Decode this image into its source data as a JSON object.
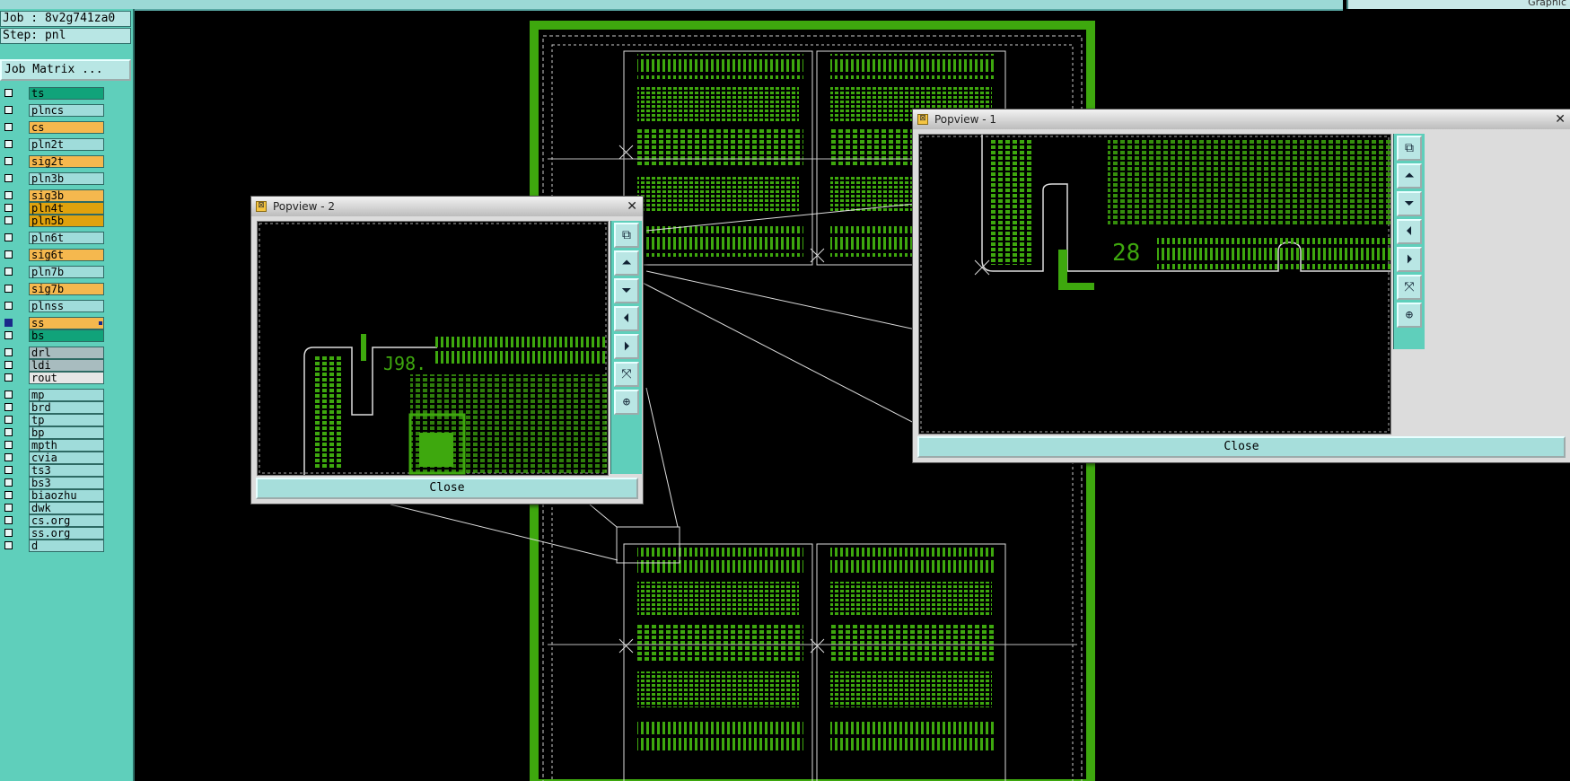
{
  "header": {
    "job": "Job : 8v2g741za0",
    "step": "Step: pnl",
    "job_matrix_button": "Job Matrix ...",
    "right_label": "Graphic"
  },
  "layers": [
    {
      "name": "ts",
      "color": "#11a37a",
      "selected": false
    },
    {
      "name": "plncs",
      "color": "#9fdcda",
      "selected": false
    },
    {
      "name": "cs",
      "color": "#f5b84e",
      "selected": false
    },
    {
      "name": "pln2t",
      "color": "#9fdcda",
      "selected": false
    },
    {
      "name": "sig2t",
      "color": "#f5b84e",
      "selected": false
    },
    {
      "name": "pln3b",
      "color": "#9fdcda",
      "selected": false
    },
    {
      "name": "sig3b",
      "color": "#f5b84e",
      "selected": false
    },
    {
      "name": "pln4t",
      "color": "#e0a20d",
      "selected": false
    },
    {
      "name": "pln5b",
      "color": "#e0a20d",
      "selected": false
    },
    {
      "name": "pln6t",
      "color": "#9fdcda",
      "selected": false
    },
    {
      "name": "sig6t",
      "color": "#f5b84e",
      "selected": false
    },
    {
      "name": "pln7b",
      "color": "#9fdcda",
      "selected": false
    },
    {
      "name": "sig7b",
      "color": "#f5b84e",
      "selected": false
    },
    {
      "name": "plnss",
      "color": "#9fdcda",
      "selected": false
    },
    {
      "name": "ss",
      "color": "#f5b84e",
      "selected": true
    },
    {
      "name": "bs",
      "color": "#11a37a",
      "selected": false
    },
    {
      "name": "drl",
      "color": "#a8bcbf",
      "selected": false
    },
    {
      "name": "ldi",
      "color": "#a8bcbf",
      "selected": false
    },
    {
      "name": "rout",
      "color": "#e6e6e6",
      "selected": false
    },
    {
      "name": "mp",
      "color": "#9fdcda",
      "selected": false
    },
    {
      "name": "brd",
      "color": "#9fdcda",
      "selected": false
    },
    {
      "name": "tp",
      "color": "#9fdcda",
      "selected": false
    },
    {
      "name": "bp",
      "color": "#9fdcda",
      "selected": false
    },
    {
      "name": "mpth",
      "color": "#9fdcda",
      "selected": false
    },
    {
      "name": "cvia",
      "color": "#9fdcda",
      "selected": false
    },
    {
      "name": "ts3",
      "color": "#9fdcda",
      "selected": false
    },
    {
      "name": "bs3",
      "color": "#9fdcda",
      "selected": false
    },
    {
      "name": "biaozhu",
      "color": "#9fdcda",
      "selected": false
    },
    {
      "name": "dwk",
      "color": "#9fdcda",
      "selected": false
    },
    {
      "name": "cs.org",
      "color": "#9fdcda",
      "selected": false
    },
    {
      "name": "ss.org",
      "color": "#9fdcda",
      "selected": false
    },
    {
      "name": "d",
      "color": "#9fdcda",
      "selected": false
    }
  ],
  "popview2": {
    "title": "Popview - 2",
    "close_label": "Close",
    "board_text": "J98."
  },
  "popview1": {
    "title": "Popview - 1",
    "close_label": "Close",
    "board_text": "28"
  },
  "colors": {
    "trace": "#3ea80e",
    "panel": "#5fcfbb"
  }
}
